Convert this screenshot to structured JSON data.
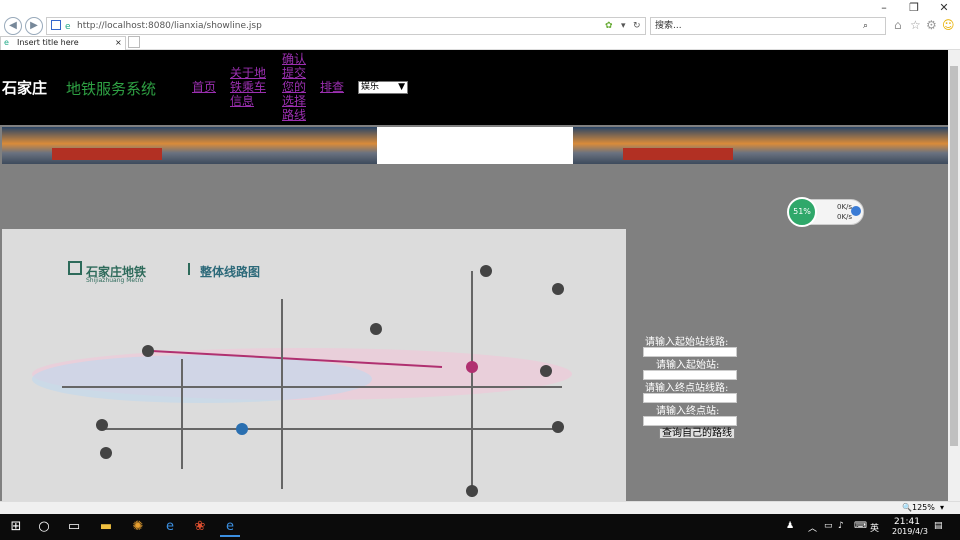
{
  "browser": {
    "url": "http://localhost:8080/lianxia/showline.jsp",
    "search_placeholder": "搜索...",
    "tab_title": "Insert title here",
    "zoom": "125%"
  },
  "header": {
    "brand": "石家庄",
    "brand_sub": "地铁服务系统",
    "nav": [
      {
        "label": "首页"
      },
      {
        "label": "关于地铁乘车信息"
      },
      {
        "label": "确认提交您的选择路线"
      },
      {
        "label": "排查"
      }
    ],
    "select_value": "娱乐"
  },
  "map": {
    "title": "石家庄地铁",
    "title_en": "Shijiazhuang Metro",
    "subtitle": "整体线路图"
  },
  "form": {
    "start_line_label": "请输入起始站线路:",
    "start_station_label": "请输入起始站:",
    "end_line_label": "请输入终点站线路:",
    "end_station_label": "请输入终点站:",
    "submit_label": "查询自己的路线"
  },
  "widget": {
    "percent": "51%",
    "up_speed": "0K/s",
    "down_speed": "0K/s"
  },
  "taskbar": {
    "time": "21:41",
    "date": "2019/4/3",
    "ime": "英"
  },
  "colors": {
    "page_bg": "#808080",
    "header_bg": "#000000",
    "brand_green": "#2ea043",
    "link_purple": "#9b2fb0"
  }
}
